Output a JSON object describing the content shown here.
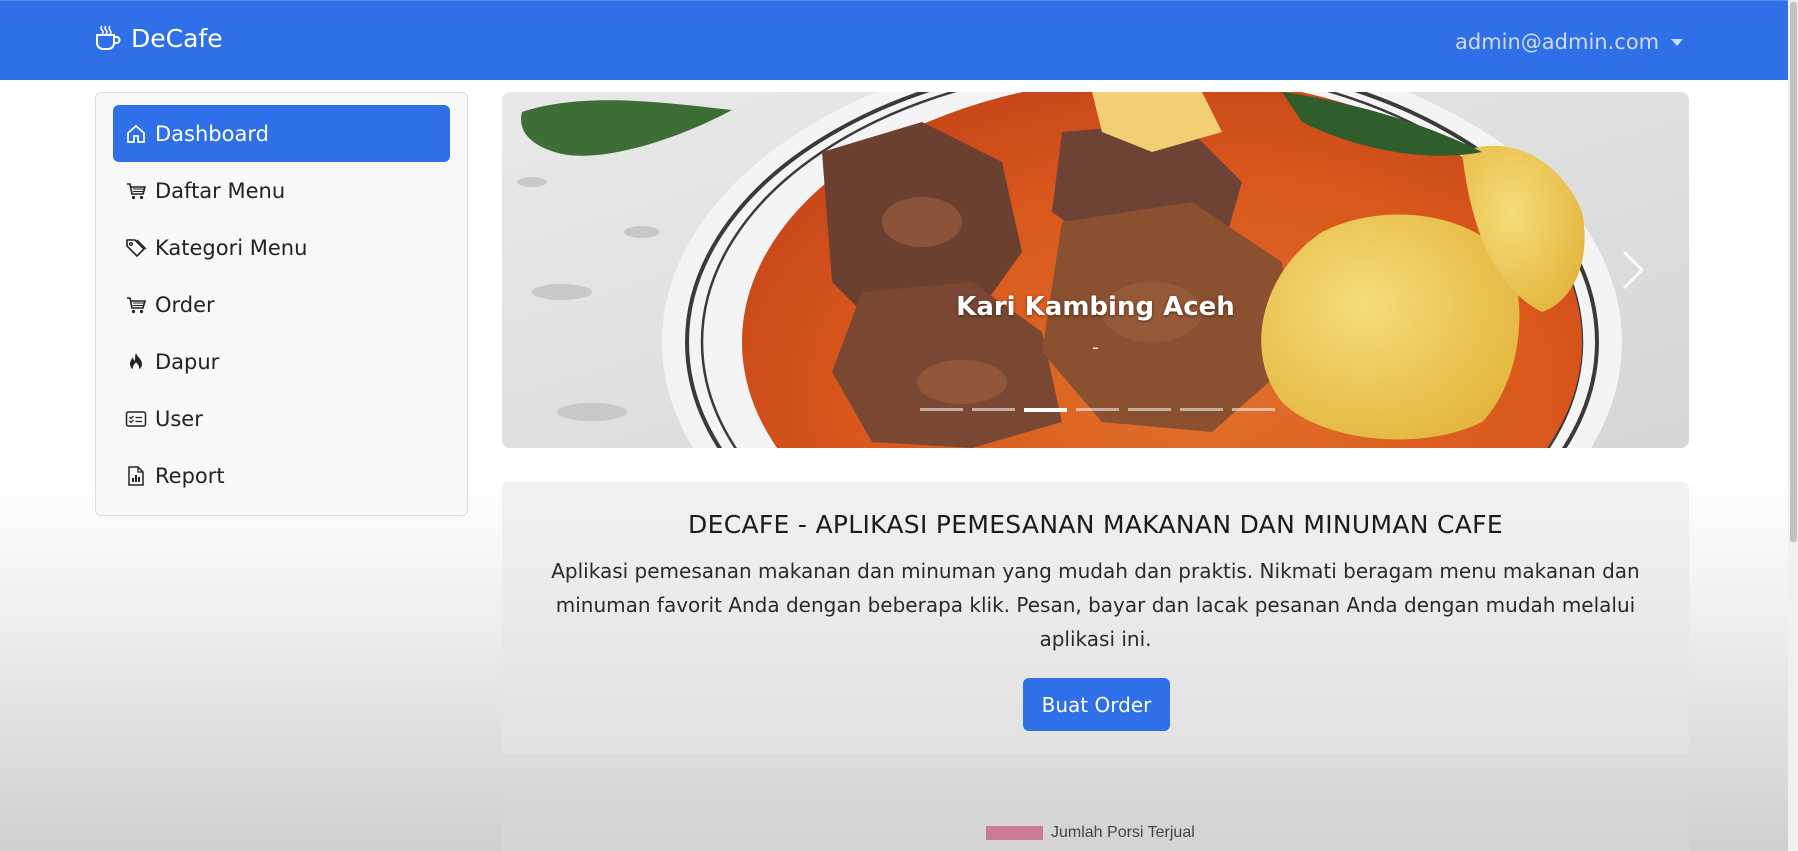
{
  "navbar": {
    "brand": "DeCafe",
    "brand_icon": "coffee-cup-icon",
    "user_email": "admin@admin.com",
    "accent_color": "#2f6fe8"
  },
  "sidebar": {
    "items": [
      {
        "label": "Dashboard",
        "icon": "house-icon",
        "active": true
      },
      {
        "label": "Daftar Menu",
        "icon": "cart-icon",
        "active": false
      },
      {
        "label": "Kategori Menu",
        "icon": "tags-icon",
        "active": false
      },
      {
        "label": "Order",
        "icon": "cart-icon",
        "active": false
      },
      {
        "label": "Dapur",
        "icon": "fire-icon",
        "active": false
      },
      {
        "label": "User",
        "icon": "id-card-icon",
        "active": false
      },
      {
        "label": "Report",
        "icon": "file-chart-icon",
        "active": false
      }
    ]
  },
  "carousel": {
    "caption_title": "Kari Kambing Aceh",
    "caption_subtitle": "-",
    "slide_count": 7,
    "active_index": 2
  },
  "hero": {
    "title": "DECAFE - APLIKASI PEMESANAN MAKANAN DAN MINUMAN CAFE",
    "text": "Aplikasi pemesanan makanan dan minuman yang mudah dan praktis. Nikmati beragam menu makanan dan minuman favorit Anda dengan beberapa klik. Pesan, bayar dan lacak pesanan Anda dengan mudah melalui aplikasi ini.",
    "button_label": "Buat Order"
  },
  "chart": {
    "legend_label": "Jumlah Porsi Terjual",
    "legend_color": "#c97a94"
  }
}
